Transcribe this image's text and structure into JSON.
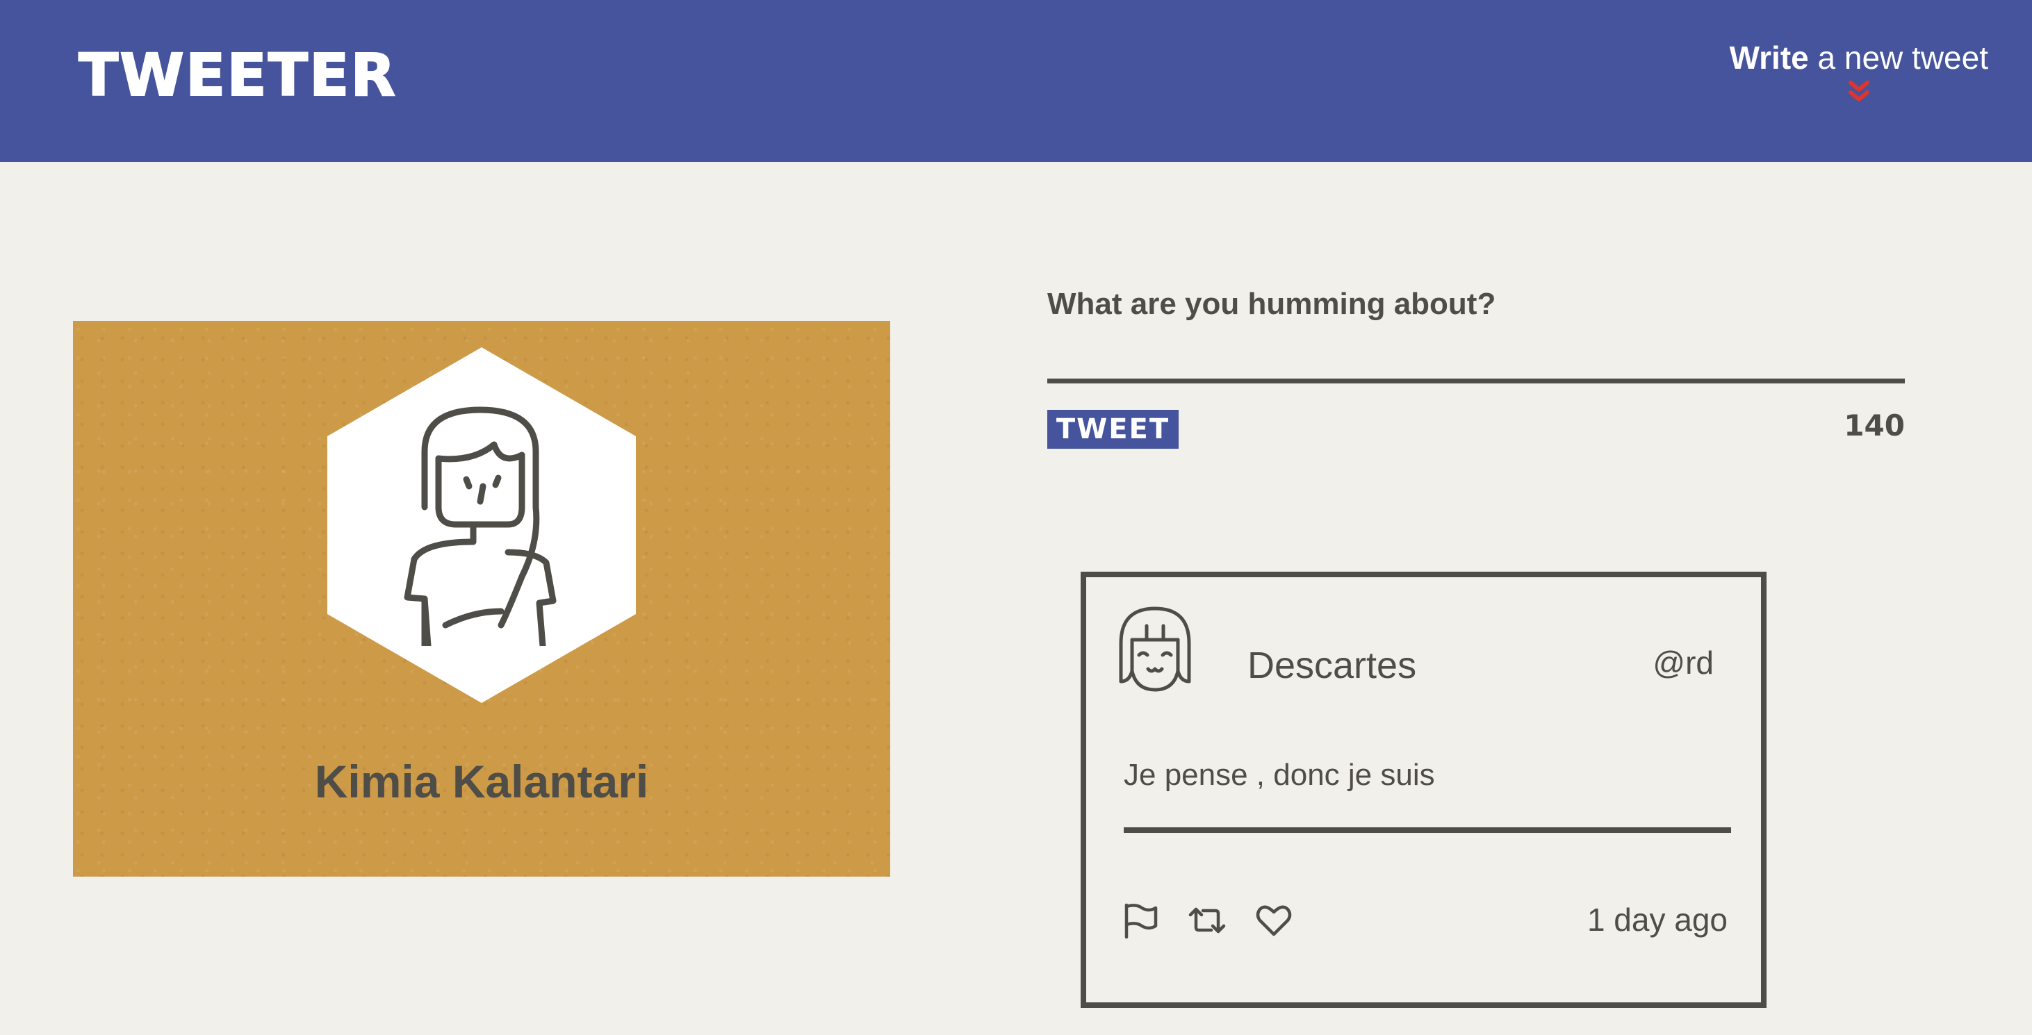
{
  "header": {
    "brand": "TWEETER",
    "write_strong": "Write",
    "write_rest": " a new tweet",
    "chevron_icon": "double-chevron-down-icon",
    "background": "#45549c",
    "chevron_color": "#e0342c"
  },
  "profile": {
    "name": "Kimia Kalantari",
    "avatar_icon": "user-avatar-icon",
    "card_color": "#cd9a48"
  },
  "compose": {
    "label": "What are you humming about?",
    "input_value": "",
    "tweet_button": "TWEET",
    "counter": "140"
  },
  "tweets": [
    {
      "author": "Descartes",
      "handle": "@rd",
      "text": "Je pense , donc je suis",
      "time": "1 day ago",
      "avatar_icon": "smiling-face-avatar-icon",
      "actions": [
        "flag-icon",
        "retweet-icon",
        "heart-icon"
      ]
    }
  ],
  "colors": {
    "background": "#f2f0eb",
    "text": "#4f4d47",
    "accent": "#45549c"
  }
}
